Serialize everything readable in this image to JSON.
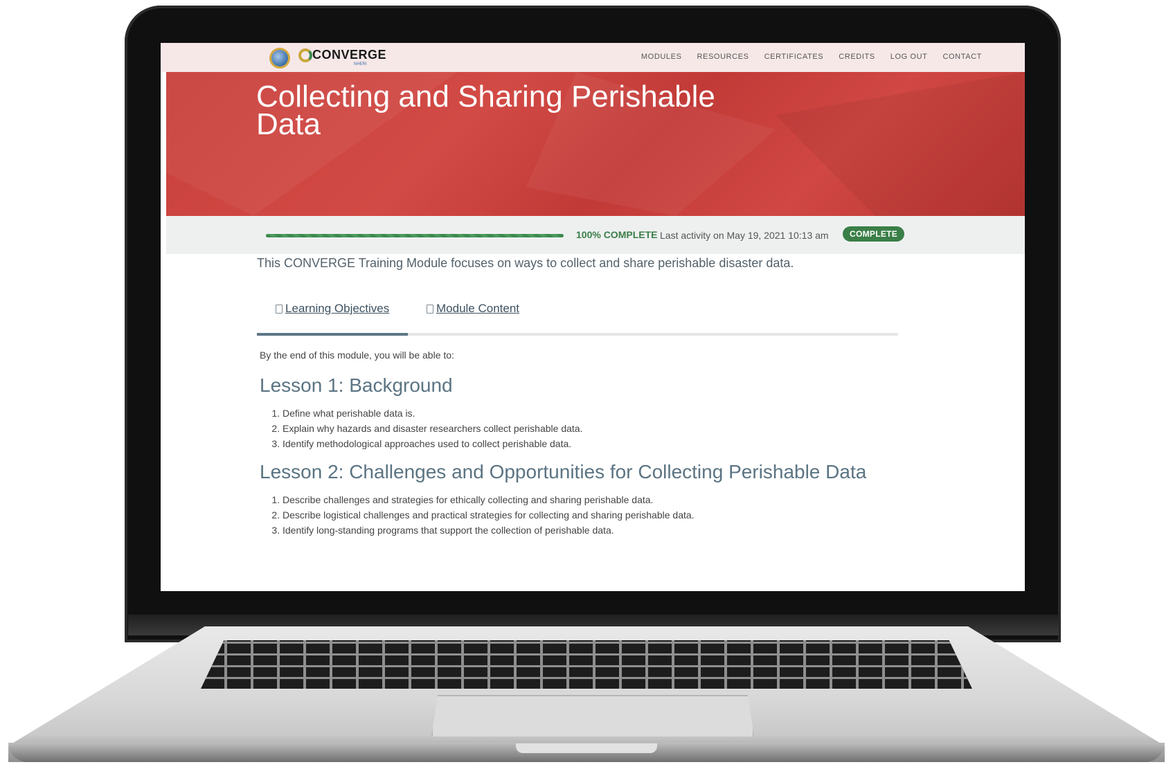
{
  "site": {
    "logo_text": "CONVERGE",
    "logo_sub": "NHERI"
  },
  "nav": [
    "MODULES",
    "RESOURCES",
    "CERTIFICATES",
    "CREDITS",
    "LOG OUT",
    "CONTACT"
  ],
  "hero": {
    "title": "Collecting and Sharing Perishable Data"
  },
  "progress": {
    "percent": 100,
    "percent_label": "100% COMPLETE",
    "last_activity": "Last activity on May 19, 2021 10:13 am",
    "badge": "COMPLETE"
  },
  "intro": "This CONVERGE Training Module focuses on ways to collect and share perishable disaster data.",
  "tabs": [
    {
      "label": "Learning Objectives",
      "active": true
    },
    {
      "label": "Module Content",
      "active": false
    }
  ],
  "lead": "By the end of this module, you will be able to:",
  "lessons": [
    {
      "title": "Lesson 1: Background",
      "items": [
        "Define what perishable data is.",
        "Explain why hazards and disaster researchers collect perishable data.",
        "Identify methodological approaches used to collect perishable data."
      ]
    },
    {
      "title": "Lesson 2: Challenges and Opportunities for Collecting Perishable Data",
      "items": [
        "Describe challenges and strategies for ethically collecting and sharing perishable data.",
        "Describe logistical challenges and practical strategies for collecting and sharing perishable data.",
        "Identify long-standing programs that support the collection of perishable data."
      ]
    }
  ],
  "colors": {
    "hero_red": "#c9403c",
    "progress_green": "#3a7f47",
    "heading_slate": "#5b7483"
  }
}
